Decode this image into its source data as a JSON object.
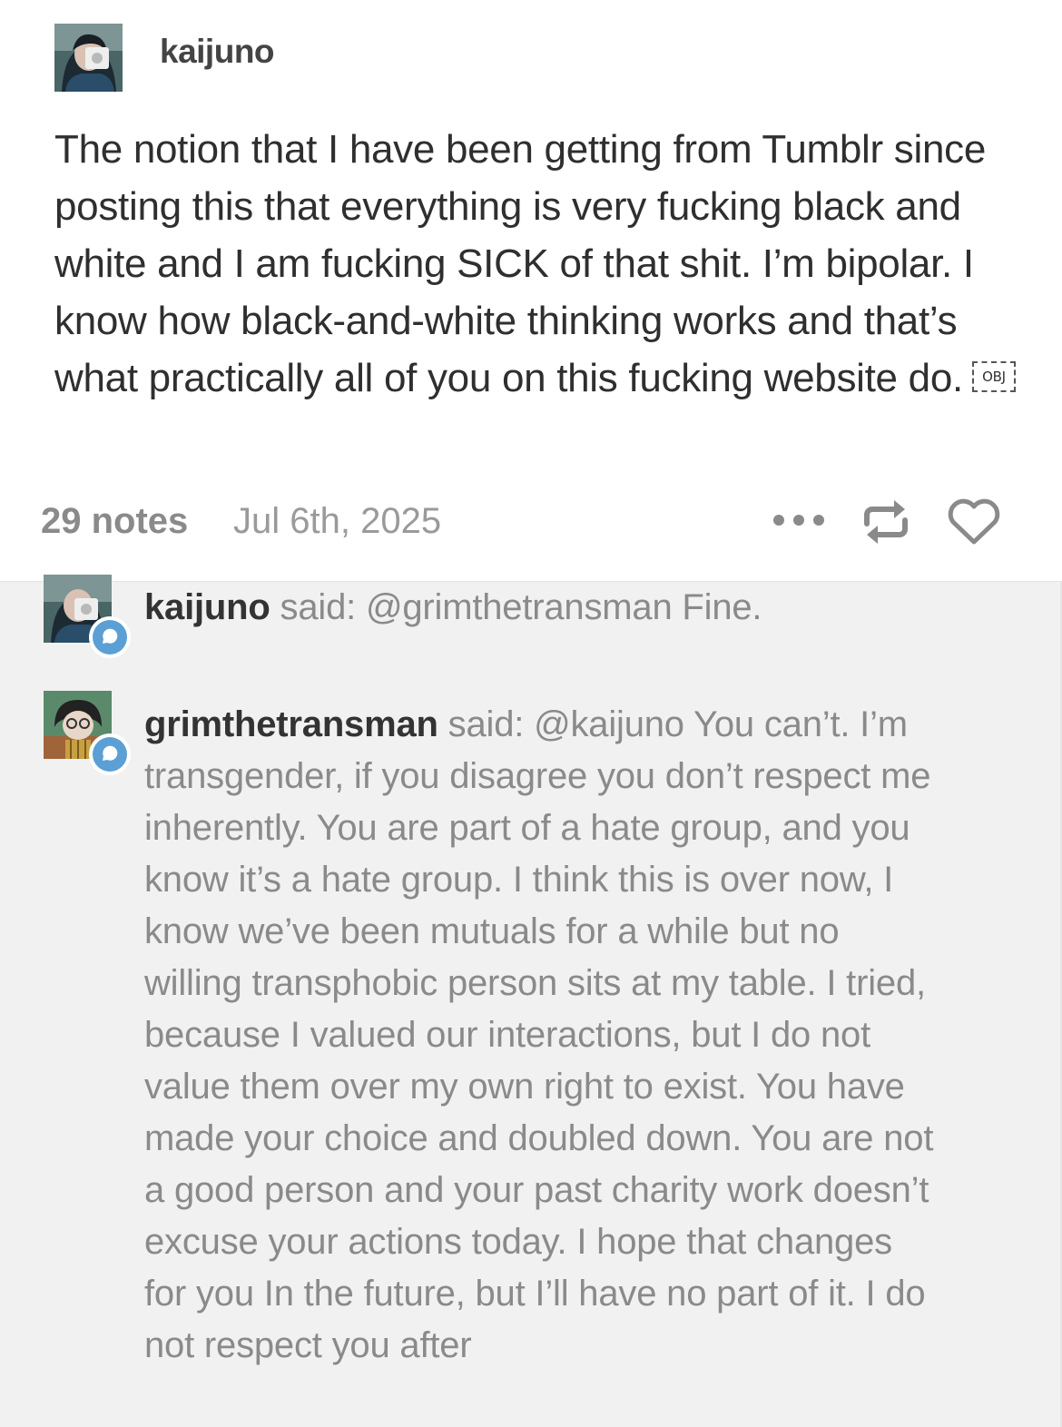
{
  "post": {
    "username": "kaijuno",
    "body": "The notion that I have been getting from Tumblr since posting this that everything is very fucking black and white and I am fucking SICK of that shit. I’m bipolar. I know how black-and-white thinking works and that’s what practically all of you on this fucking website do.",
    "obj_glyph": "OBJ",
    "notes_count": "29 notes",
    "date": "Jul 6th, 2025",
    "icons": {
      "more": "more-dots-icon",
      "reblog": "reblog-icon",
      "like": "heart-icon"
    }
  },
  "colors": {
    "badge_blue": "#5b9fd5",
    "notes_background": "#f1f1f1",
    "meta_gray": "#8a8a8a"
  },
  "notes": [
    {
      "username": "kaijuno",
      "said": "said:",
      "message": "@grimthetransman Fine."
    },
    {
      "username": "grimthetransman",
      "said": "said:",
      "message": "@kaijuno You can’t. I’m transgender, if you disagree you don’t respect me inherently. You are part of a hate group, and you know it’s a hate group. I think this is over now, I know we’ve been mutuals for a while but no willing transphobic person sits at my table. I tried, because I valued our interactions, but I do not value them over my own right to exist. You have made your choice and doubled down. You are not a good person and your past charity work doesn’t excuse your actions today. I hope that changes for you In the future, but I’ll have no part of it. I do not respect you after"
    }
  ]
}
